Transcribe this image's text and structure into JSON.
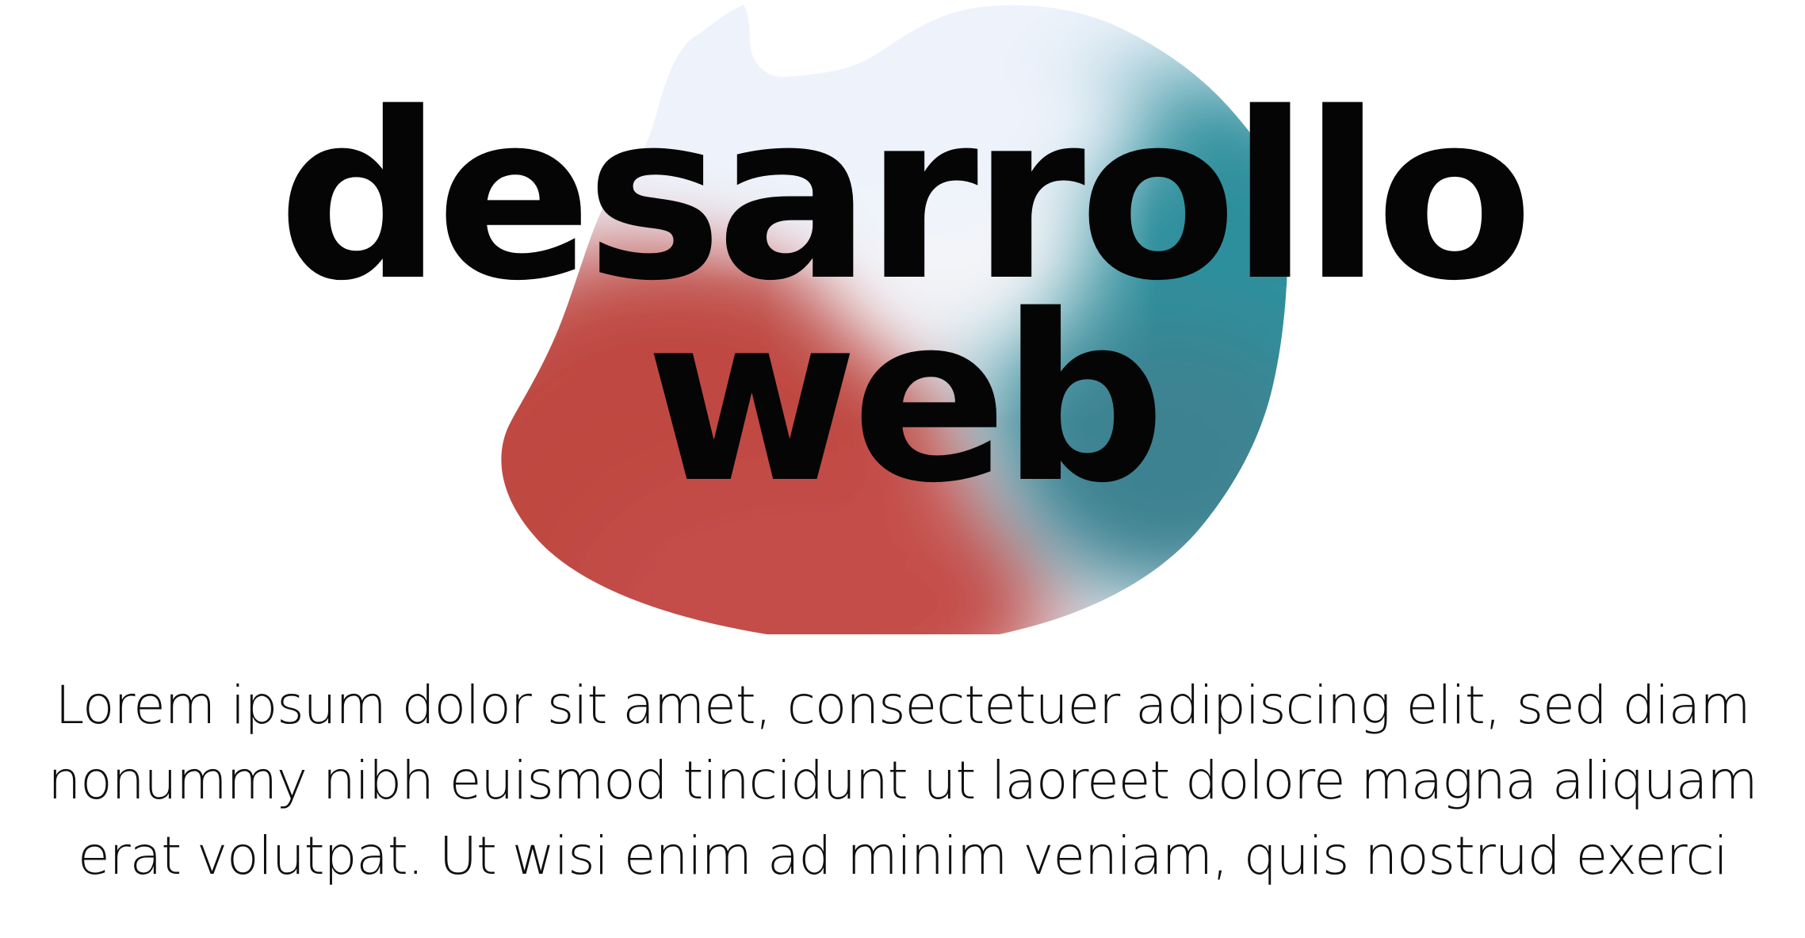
{
  "headline": {
    "line1": "desarrollo",
    "line2": "web"
  },
  "body": {
    "lines": [
      "Lorem ipsum dolor sit amet, consectetuer adipiscing elit, sed diam",
      "nonummy nibh euismod tincidunt ut laoreet dolore magna aliquam",
      "erat volutpat. Ut wisi enim ad minim veniam, quis nostrud exerci"
    ]
  },
  "colors": {
    "background": "#ffffff",
    "text": "#050505",
    "blob_light": "#eef3fb",
    "blob_red": "#bf4843",
    "blob_teal": "#2f8f9c"
  }
}
